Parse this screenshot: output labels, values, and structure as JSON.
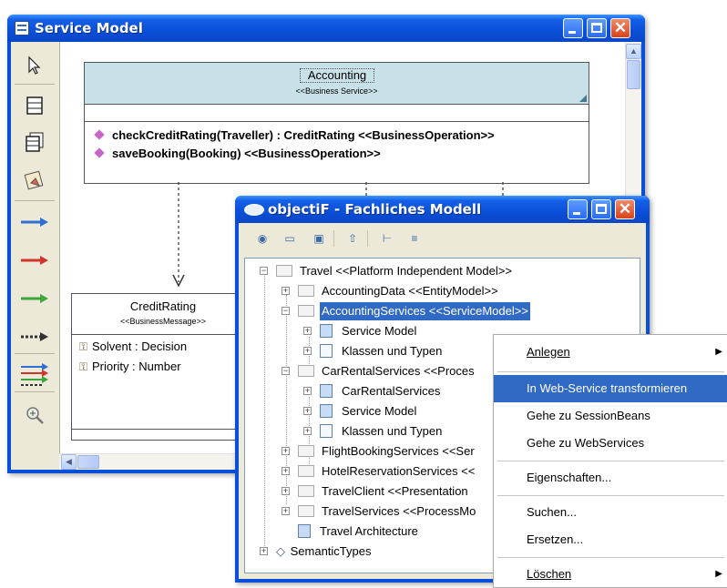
{
  "service_model_window": {
    "title": "Service Model",
    "accounting": {
      "name": "Accounting",
      "stereotype": "<<Business Service>>",
      "operations": [
        "checkCreditRating(Traveller) : CreditRating <<BusinessOperation>>",
        "saveBooking(Booking) <<BusinessOperation>>"
      ]
    },
    "credit_rating": {
      "name": "CreditRating",
      "stereotype": "<<BusinessMessage>>",
      "attributes": [
        "Solvent : Decision",
        "Priority : Number"
      ]
    },
    "palette_icons": [
      "pointer-icon",
      "class-icon",
      "package-icon",
      "component-icon",
      "blue-arrow-icon",
      "red-arrow-icon",
      "green-arrow-icon",
      "dashed-arrow-icon",
      "multi-arrow-icon",
      "zoom-icon"
    ]
  },
  "objectif_window": {
    "title": "objectiF - Fachliches Modell",
    "tree": [
      {
        "label": "Travel <<Platform Independent Model>>"
      },
      {
        "label": "AccountingData <<EntityModel>>"
      },
      {
        "label": "AccountingServices <<ServiceModel>>",
        "selected": true
      },
      {
        "label": "Service Model"
      },
      {
        "label": "Klassen und Typen"
      },
      {
        "label": "CarRentalServices <<Proces"
      },
      {
        "label": "CarRentalServices"
      },
      {
        "label": "Service Model"
      },
      {
        "label": "Klassen und Typen"
      },
      {
        "label": "FlightBookingServices <<Ser"
      },
      {
        "label": "HotelReservationServices <<"
      },
      {
        "label": "TravelClient <<Presentation"
      },
      {
        "label": "TravelServices <<ProcessMo"
      },
      {
        "label": "Travel Architecture"
      },
      {
        "label": "SemanticTypes"
      }
    ]
  },
  "context_menu": {
    "items": [
      {
        "label": "Anlegen",
        "submenu": true
      },
      {
        "label": "In Web-Service transformieren",
        "highlighted": true
      },
      {
        "label": "Gehe zu SessionBeans"
      },
      {
        "label": "Gehe zu WebServices"
      },
      {
        "label": "Eigenschaften..."
      },
      {
        "label": "Suchen..."
      },
      {
        "label": "Ersetzen..."
      },
      {
        "label": "Löschen",
        "submenu": true
      }
    ]
  },
  "colors": {
    "title_bar": "#0a4fd8",
    "selection": "#316ac5",
    "class_header": "#c8e1e8"
  }
}
